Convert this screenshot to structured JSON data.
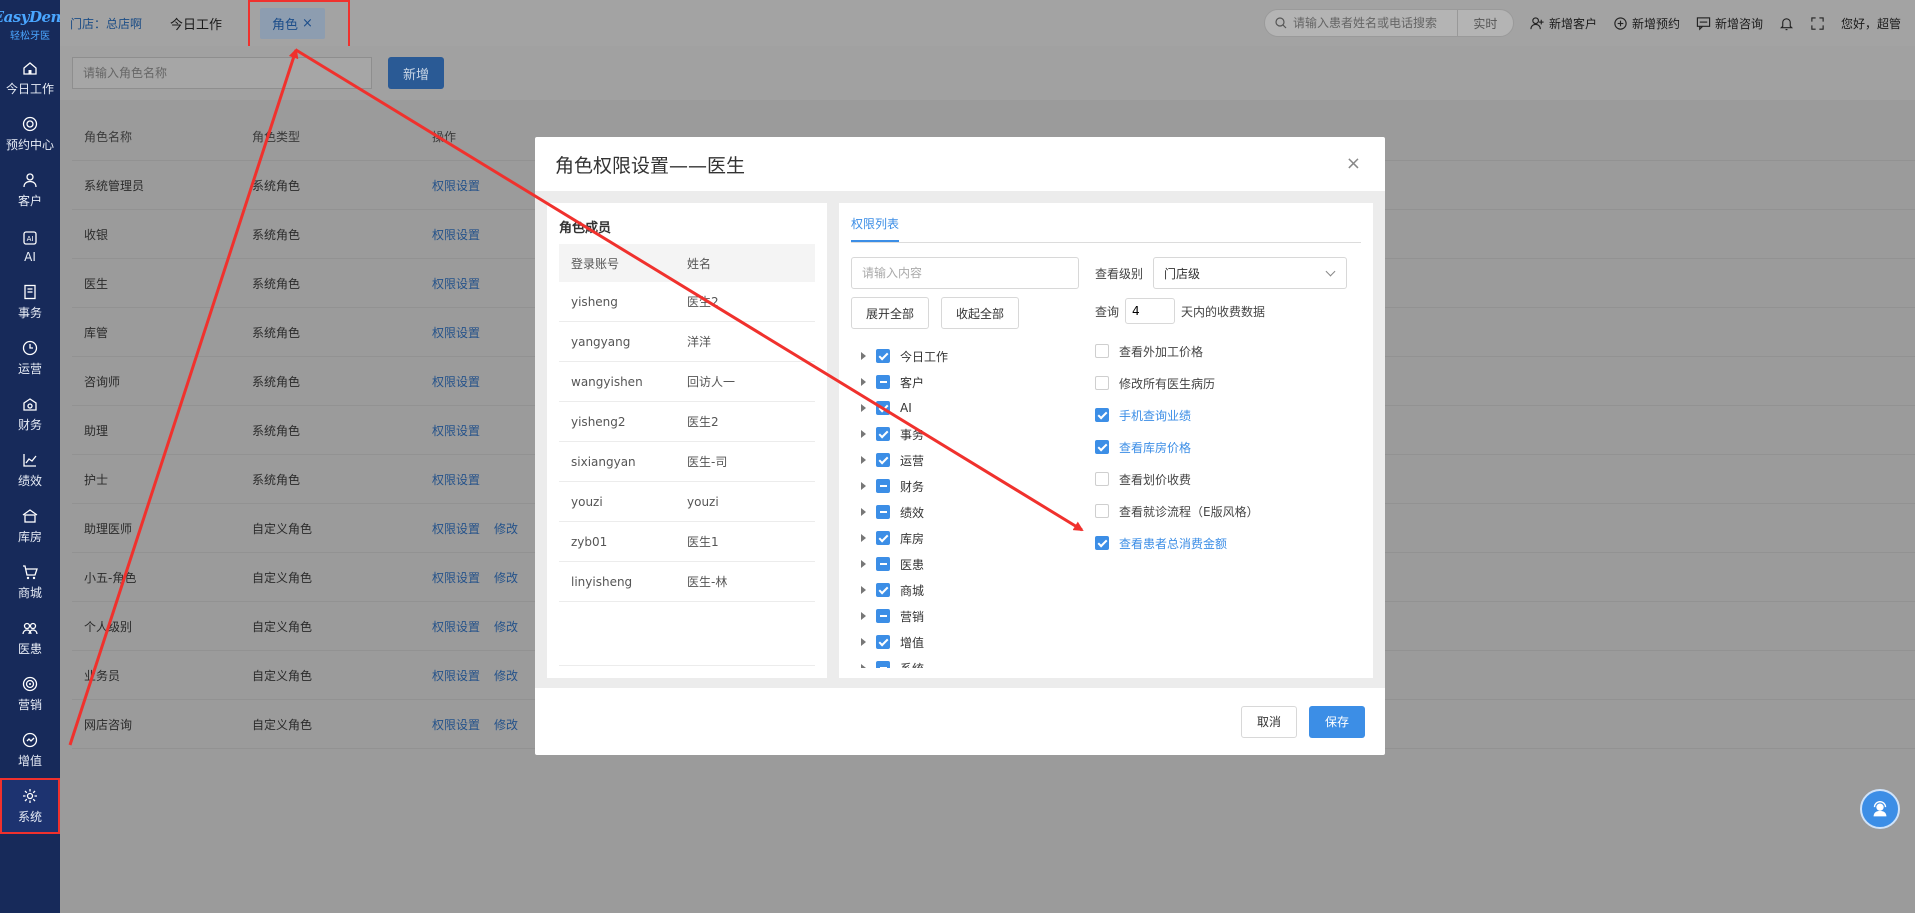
{
  "sidebar": {
    "brand": "EasyDent",
    "brand_sub": "轻松牙医",
    "items": [
      {
        "label": "今日工作",
        "icon": "home-icon"
      },
      {
        "label": "预约中心",
        "icon": "calendar-icon"
      },
      {
        "label": "客户",
        "icon": "user-icon"
      },
      {
        "label": "AI",
        "icon": "ai-icon"
      },
      {
        "label": "事务",
        "icon": "task-icon"
      },
      {
        "label": "运营",
        "icon": "clock-icon"
      },
      {
        "label": "财务",
        "icon": "finance-icon"
      },
      {
        "label": "绩效",
        "icon": "chart-icon"
      },
      {
        "label": "库房",
        "icon": "warehouse-icon"
      },
      {
        "label": "商城",
        "icon": "cart-icon"
      },
      {
        "label": "医患",
        "icon": "doctor-icon"
      },
      {
        "label": "营销",
        "icon": "target-icon"
      },
      {
        "label": "增值",
        "icon": "growth-icon"
      },
      {
        "label": "系统",
        "icon": "gear-icon"
      }
    ]
  },
  "topbar": {
    "store": "门店：总店啊",
    "tabs": [
      {
        "label": "今日工作"
      },
      {
        "label": "角色"
      }
    ],
    "tab_close": "×",
    "search_placeholder": "请输入患者姓名或电话搜索",
    "realtime": "实时",
    "actions": [
      {
        "label": "新增客户",
        "icon": "add-user-icon"
      },
      {
        "label": "新增预约",
        "icon": "add-appointment-icon"
      },
      {
        "label": "新增咨询",
        "icon": "chat-icon"
      }
    ],
    "greeting": "您好，超管"
  },
  "roles_page": {
    "search_placeholder": "请输入角色名称",
    "add_button": "新增",
    "columns": [
      "角色名称",
      "角色类型",
      "操作"
    ],
    "perm_link": "权限设置",
    "edit_link": "修改",
    "rows": [
      {
        "name": "系统管理员",
        "type": "系统角色",
        "editable": false
      },
      {
        "name": "收银",
        "type": "系统角色",
        "editable": false
      },
      {
        "name": "医生",
        "type": "系统角色",
        "editable": false
      },
      {
        "name": "库管",
        "type": "系统角色",
        "editable": false
      },
      {
        "name": "咨询师",
        "type": "系统角色",
        "editable": false
      },
      {
        "name": "助理",
        "type": "系统角色",
        "editable": false
      },
      {
        "name": "护士",
        "type": "系统角色",
        "editable": false
      },
      {
        "name": "助理医师",
        "type": "自定义角色",
        "editable": true
      },
      {
        "name": "小五-角色",
        "type": "自定义角色",
        "editable": true
      },
      {
        "name": "个人级别",
        "type": "自定义角色",
        "editable": true
      },
      {
        "name": "业务员",
        "type": "自定义角色",
        "editable": true
      },
      {
        "name": "网店咨询",
        "type": "自定义角色",
        "editable": true
      }
    ]
  },
  "modal": {
    "title": "角色权限设置——医生",
    "close": "×",
    "members": {
      "title": "角色成员",
      "columns": [
        "登录账号",
        "姓名"
      ],
      "rows": [
        {
          "account": "yisheng",
          "name": "医生2"
        },
        {
          "account": "yangyang",
          "name": "洋洋"
        },
        {
          "account": "wangyishen",
          "name": "回访人一"
        },
        {
          "account": "yisheng2",
          "name": "医生2"
        },
        {
          "account": "sixiangyan",
          "name": "医生-司"
        },
        {
          "account": "youzi",
          "name": "youzi"
        },
        {
          "account": "zyb01",
          "name": "医生1"
        },
        {
          "account": "linyisheng",
          "name": "医生-林"
        }
      ]
    },
    "permissions": {
      "tab": "权限列表",
      "search_placeholder": "请输入内容",
      "expand_all": "展开全部",
      "collapse_all": "收起全部",
      "tree": [
        {
          "label": "今日工作",
          "state": "checked"
        },
        {
          "label": "客户",
          "state": "partial"
        },
        {
          "label": "AI",
          "state": "checked"
        },
        {
          "label": "事务",
          "state": "checked"
        },
        {
          "label": "运营",
          "state": "checked"
        },
        {
          "label": "财务",
          "state": "partial"
        },
        {
          "label": "绩效",
          "state": "partial"
        },
        {
          "label": "库房",
          "state": "checked"
        },
        {
          "label": "医患",
          "state": "partial"
        },
        {
          "label": "商城",
          "state": "checked"
        },
        {
          "label": "营销",
          "state": "partial"
        },
        {
          "label": "增值",
          "state": "checked"
        },
        {
          "label": "系统",
          "state": "partial"
        }
      ],
      "level_label": "查看级别",
      "level_value": "门店级",
      "query_prefix": "查询",
      "query_days": "4",
      "query_suffix": "天内的收费数据",
      "options": [
        {
          "label": "查看外加工价格",
          "checked": false
        },
        {
          "label": "修改所有医生病历",
          "checked": false
        },
        {
          "label": "手机查询业绩",
          "checked": true
        },
        {
          "label": "查看库房价格",
          "checked": true
        },
        {
          "label": "查看划价收费",
          "checked": false
        },
        {
          "label": "查看就诊流程（E版风格）",
          "checked": false
        },
        {
          "label": "查看患者总消费金额",
          "checked": true
        }
      ]
    },
    "cancel": "取消",
    "save": "保存"
  },
  "colors": {
    "sidebar_bg": "#172a5a",
    "accent": "#3c8ee6",
    "annotation_red": "#f0312d"
  }
}
